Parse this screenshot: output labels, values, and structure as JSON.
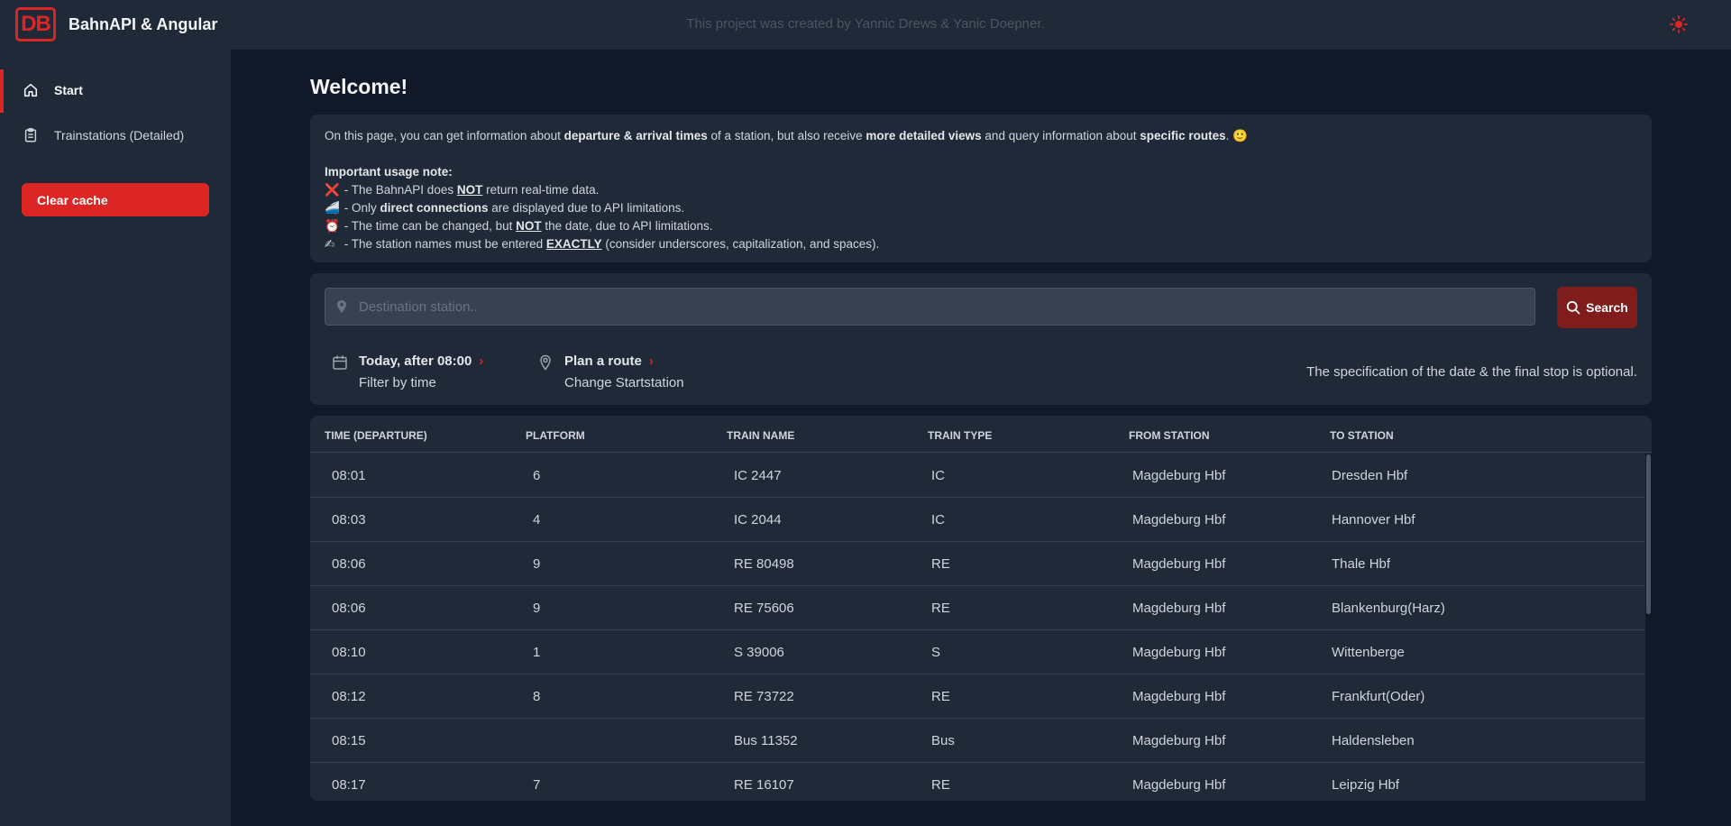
{
  "header": {
    "logo_text": "DB",
    "app_title": "BahnAPI & Angular",
    "credits": "This project was created by Yannic Drews & Yanic Doepner.",
    "theme_icon": "sun-icon"
  },
  "sidebar": {
    "items": [
      {
        "label": "Start",
        "icon": "home-icon",
        "active": true
      },
      {
        "label": "Trainstations (Detailed)",
        "icon": "clipboard-icon",
        "active": false
      }
    ],
    "clear_cache_label": "Clear cache"
  },
  "main": {
    "title": "Welcome!",
    "info": {
      "intro_1": "On this page, you can get information about ",
      "intro_b1": "departure & arrival times",
      "intro_2": " of a station, but also receive ",
      "intro_b2": "more detailed views",
      "intro_3": " and query information about ",
      "intro_b3": "specific routes",
      "intro_4": ". 🙂",
      "note_heading": "Important usage note:",
      "line1_emoji": "❌",
      "line1_a": " - The BahnAPI does ",
      "line1_u": "NOT",
      "line1_b": " return real-time data.",
      "line2_emoji": "🚄",
      "line2_a": " - Only ",
      "line2_bold": "direct connections",
      "line2_b": " are displayed due to API limitations.",
      "line3_emoji": "⏰",
      "line3_a": " - The time can be changed, but ",
      "line3_u": "NOT",
      "line3_b": " the date, due to API limitations.",
      "line4_emoji": "✍",
      "line4_a": " - The station names must be entered ",
      "line4_u": "EXACTLY",
      "line4_b": " (consider underscores, capitalization, and spaces)."
    },
    "search": {
      "placeholder": "Destination station..",
      "value": "",
      "button_label": "Search",
      "time_filter_title": "Today, after 08:00",
      "time_filter_sub": "Filter by time",
      "route_title": "Plan a route",
      "route_sub": "Change Startstation",
      "optional_note": "The specification of the date & the final stop is optional."
    },
    "table": {
      "headers": [
        "TIME (DEPARTURE)",
        "PLATFORM",
        "TRAIN NAME",
        "TRAIN TYPE",
        "FROM STATION",
        "TO STATION"
      ],
      "rows": [
        [
          "08:01",
          "6",
          "IC 2447",
          "IC",
          "Magdeburg Hbf",
          "Dresden Hbf"
        ],
        [
          "08:03",
          "4",
          "IC 2044",
          "IC",
          "Magdeburg Hbf",
          "Hannover Hbf"
        ],
        [
          "08:06",
          "9",
          "RE 80498",
          "RE",
          "Magdeburg Hbf",
          "Thale Hbf"
        ],
        [
          "08:06",
          "9",
          "RE 75606",
          "RE",
          "Magdeburg Hbf",
          "Blankenburg(Harz)"
        ],
        [
          "08:10",
          "1",
          "S 39006",
          "S",
          "Magdeburg Hbf",
          "Wittenberge"
        ],
        [
          "08:12",
          "8",
          "RE 73722",
          "RE",
          "Magdeburg Hbf",
          "Frankfurt(Oder)"
        ],
        [
          "08:15",
          "",
          "Bus 11352",
          "Bus",
          "Magdeburg Hbf",
          "Haldensleben"
        ],
        [
          "08:17",
          "7",
          "RE 16107",
          "RE",
          "Magdeburg Hbf",
          "Leipzig Hbf"
        ]
      ]
    }
  },
  "colors": {
    "accent": "#dc2626",
    "background": "#111827",
    "surface": "#1f2937"
  }
}
